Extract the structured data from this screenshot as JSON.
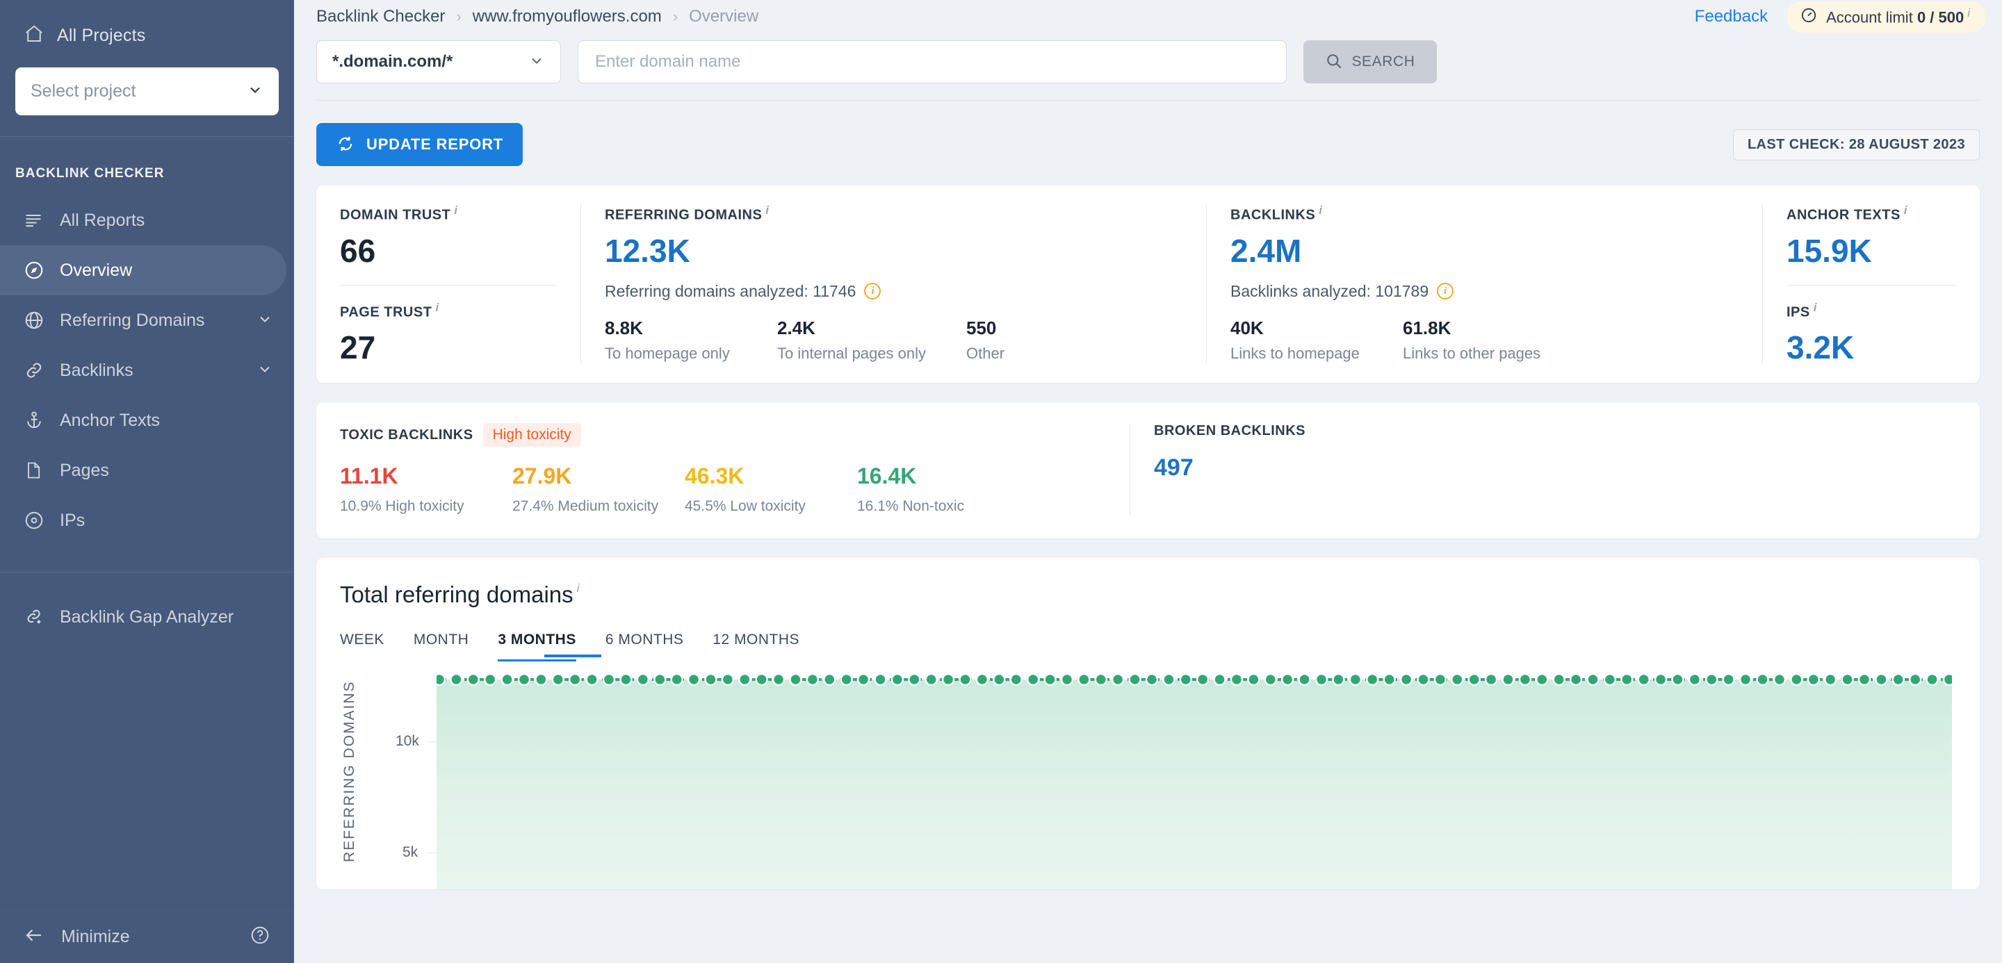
{
  "sidebar": {
    "all_projects": "All Projects",
    "project_placeholder": "Select project",
    "section_title": "BACKLINK CHECKER",
    "items": [
      {
        "label": "All Reports",
        "icon": "list-icon",
        "active": false,
        "expandable": false
      },
      {
        "label": "Overview",
        "icon": "compass-icon",
        "active": true,
        "expandable": false
      },
      {
        "label": "Referring Domains",
        "icon": "globe-icon",
        "active": false,
        "expandable": true
      },
      {
        "label": "Backlinks",
        "icon": "link-icon",
        "active": false,
        "expandable": true
      },
      {
        "label": "Anchor Texts",
        "icon": "anchor-icon",
        "active": false,
        "expandable": false
      },
      {
        "label": "Pages",
        "icon": "document-icon",
        "active": false,
        "expandable": false
      },
      {
        "label": "IPs",
        "icon": "target-icon",
        "active": false,
        "expandable": false
      }
    ],
    "gap_analyzer": "Backlink Gap Analyzer",
    "minimize": "Minimize"
  },
  "header": {
    "breadcrumbs": [
      "Backlink Checker",
      "www.fromyouflowers.com",
      "Overview"
    ],
    "feedback": "Feedback",
    "account_limit_label": "Account limit",
    "account_limit_value": "0 / 500"
  },
  "search": {
    "scope_value": "*.domain.com/*",
    "placeholder": "Enter domain name",
    "button_label": "SEARCH"
  },
  "actions": {
    "update_report": "UPDATE REPORT",
    "last_check": "LAST CHECK: 28 AUGUST 2023"
  },
  "metrics": {
    "domain_trust": {
      "label": "DOMAIN TRUST",
      "value": "66"
    },
    "page_trust": {
      "label": "PAGE TRUST",
      "value": "27"
    },
    "referring_domains": {
      "label": "REFERRING DOMAINS",
      "value": "12.3K",
      "analyzed": "Referring domains analyzed: 11746",
      "breakdown": [
        {
          "n": "8.8K",
          "c": "To homepage only"
        },
        {
          "n": "2.4K",
          "c": "To internal pages only"
        },
        {
          "n": "550",
          "c": "Other"
        }
      ]
    },
    "backlinks": {
      "label": "BACKLINKS",
      "value": "2.4M",
      "analyzed": "Backlinks analyzed: 101789",
      "breakdown": [
        {
          "n": "40K",
          "c": "Links to homepage"
        },
        {
          "n": "61.8K",
          "c": "Links to other pages"
        }
      ]
    },
    "anchor_texts": {
      "label": "ANCHOR TEXTS",
      "value": "15.9K"
    },
    "ips": {
      "label": "IPS",
      "value": "3.2K"
    }
  },
  "toxic": {
    "title": "TOXIC BACKLINKS",
    "badge": "High toxicity",
    "values": [
      {
        "n": "11.1K",
        "c": "10.9% High toxicity",
        "color": "#e8453c"
      },
      {
        "n": "27.9K",
        "c": "27.4% Medium toxicity",
        "color": "#f5a623"
      },
      {
        "n": "46.3K",
        "c": "45.5% Low toxicity",
        "color": "#f5b916"
      },
      {
        "n": "16.4K",
        "c": "16.1% Non-toxic",
        "color": "#2fa875"
      }
    ],
    "broken": {
      "label": "BROKEN BACKLINKS",
      "value": "497"
    }
  },
  "chart_panel": {
    "title": "Total referring domains",
    "tabs": [
      {
        "label": "WEEK",
        "active": false
      },
      {
        "label": "MONTH",
        "active": false
      },
      {
        "label": "3 MONTHS",
        "active": true
      },
      {
        "label": "6 MONTHS",
        "active": false
      },
      {
        "label": "12 MONTHS",
        "active": false
      }
    ]
  },
  "chart_data": {
    "type": "area",
    "title": "Total referring domains",
    "xlabel": "",
    "ylabel": "REFERRING DOMAINS",
    "ylim": [
      0,
      13500
    ],
    "yticks": [
      5000,
      10000
    ],
    "ytick_labels": [
      "5k",
      "10k"
    ],
    "grid": true,
    "legend": "none",
    "series_color": "#2fa875",
    "area_color": "#d7eee2",
    "markers": true,
    "series": [
      {
        "name": "Referring domains",
        "values": [
          12300,
          12300,
          12300,
          12300,
          12300,
          12300,
          12300,
          12300,
          12300,
          12300,
          12300,
          12300,
          12300,
          12300,
          12300,
          12300,
          12300,
          12300,
          12300,
          12300,
          12300,
          12300,
          12300,
          12300,
          12300,
          12300,
          12300,
          12300,
          12300,
          12300,
          12300,
          12300,
          12300,
          12300,
          12300,
          12300,
          12300,
          12300,
          12300,
          12300,
          12300,
          12300,
          12300,
          12300,
          12300,
          12300,
          12300,
          12300,
          12300,
          12300,
          12300,
          12300,
          12300,
          12300,
          12300,
          12300,
          12300,
          12300,
          12300,
          12300,
          12300,
          12300,
          12300,
          12300,
          12300,
          12300,
          12300,
          12300,
          12300,
          12300,
          12300,
          12300,
          12300,
          12300,
          12300,
          12300,
          12300,
          12300,
          12300,
          12300,
          12300,
          12300,
          12300,
          12300,
          12300,
          12300,
          12300,
          12300,
          12300,
          12300
        ]
      }
    ]
  }
}
